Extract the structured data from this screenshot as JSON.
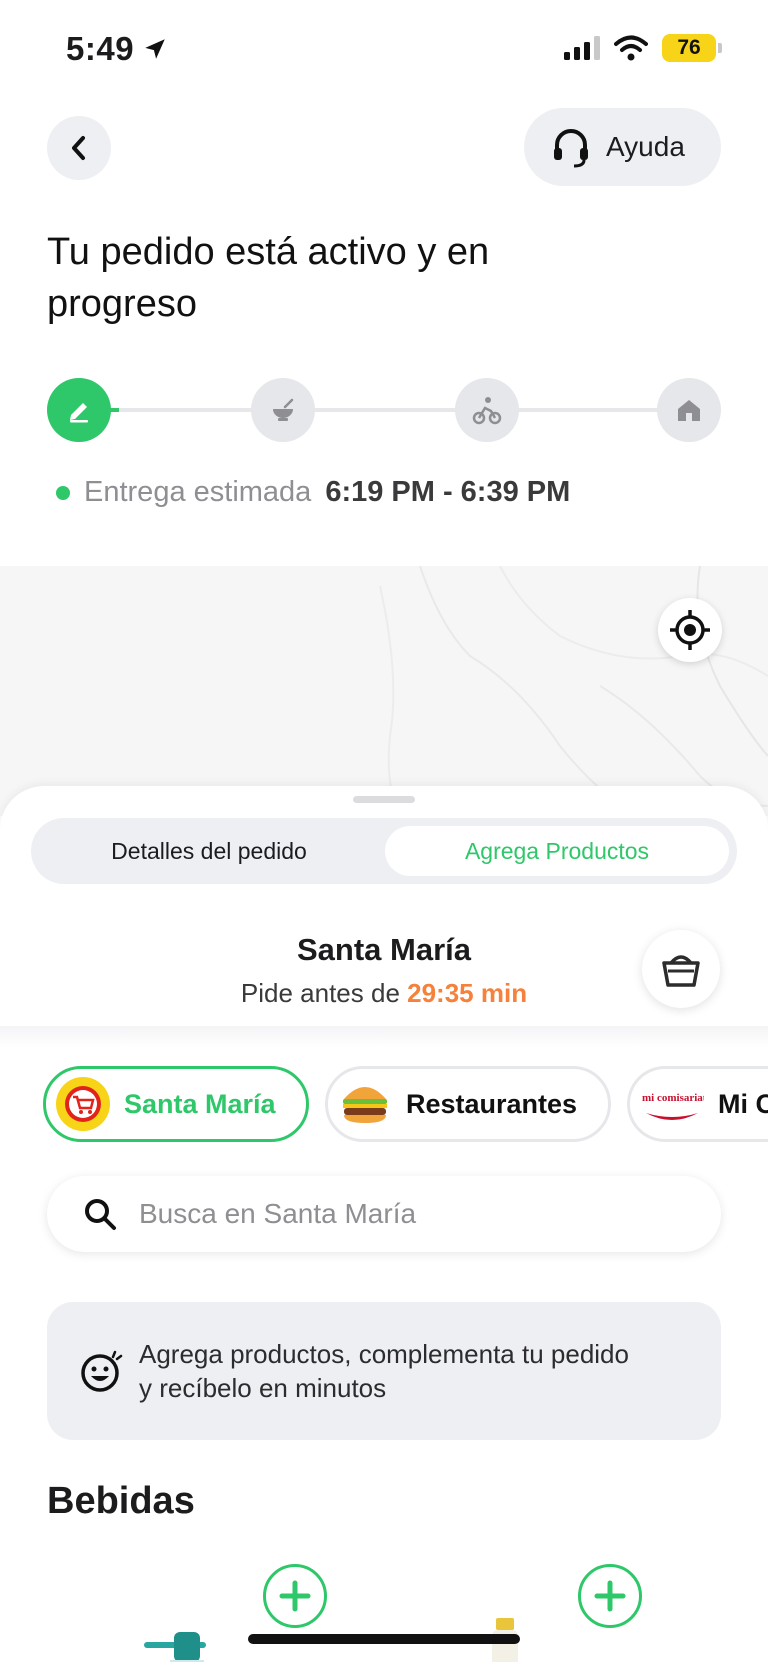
{
  "status_bar": {
    "time": "5:49",
    "battery": "76",
    "battery_color": "#f7d417"
  },
  "header": {
    "back_icon": "chevron-left-icon",
    "help_label": "Ayuda",
    "help_icon": "headset-icon",
    "title": "Tu pedido está activo y en progreso"
  },
  "progress": {
    "steps": [
      {
        "icon": "pencil-icon",
        "state": "active"
      },
      {
        "icon": "bowl-icon",
        "state": "pending"
      },
      {
        "icon": "courier-bike-icon",
        "state": "pending"
      },
      {
        "icon": "home-icon",
        "state": "pending"
      }
    ],
    "eta_label": "Entrega estimada",
    "eta_value": "6:19 PM - 6:39 PM"
  },
  "map": {
    "locate_icon": "crosshair-icon"
  },
  "sheet": {
    "tabs": [
      {
        "label": "Detalles del pedido",
        "selected": false
      },
      {
        "label": "Agrega Productos",
        "selected": true
      }
    ],
    "store_name": "Santa María",
    "order_before_label": "Pide antes de",
    "countdown": "29:35 min",
    "basket_icon": "basket-icon",
    "chips": [
      {
        "label": "Santa María",
        "icon": "cart-logo-icon",
        "selected": true
      },
      {
        "label": "Restaurantes",
        "icon": "burger-icon",
        "selected": false
      },
      {
        "label": "Mi C",
        "icon": "mi-comisariato-logo",
        "logo_text": "mi comisariato",
        "selected": false
      }
    ],
    "search_placeholder": "Busca en Santa María",
    "banner_text": "Agrega productos, complementa tu pedido y recíbelo en minutos",
    "banner_icon": "smiley-icon",
    "section_title": "Bebidas"
  },
  "colors": {
    "accent_green": "#2ec769",
    "countdown_orange": "#f5813a",
    "pill_grey": "#eeeff2"
  }
}
